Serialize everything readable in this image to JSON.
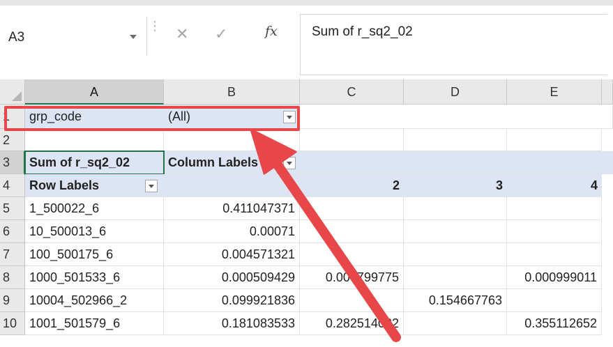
{
  "name_box": {
    "value": "A3"
  },
  "formula_bar": {
    "cancel_glyph": "✕",
    "enter_glyph": "✓",
    "fx_label": "fx",
    "content": "Sum of r_sq2_02"
  },
  "columns": [
    "A",
    "B",
    "C",
    "D",
    "E"
  ],
  "row_numbers": [
    "1",
    "2",
    "3",
    "4",
    "5",
    "6",
    "7",
    "8",
    "9",
    "10"
  ],
  "pivot": {
    "filter_field": "grp_code",
    "filter_value": "(All)",
    "values_label": "Sum of r_sq2_02",
    "column_labels_header": "Column Labels",
    "row_labels_header": "Row Labels",
    "column_keys": {
      "c": "2",
      "d": "3",
      "e": "4"
    },
    "rows": [
      {
        "label": "1_500022_6",
        "b": "0.411047371",
        "c": "",
        "d": "",
        "e": ""
      },
      {
        "label": "10_500013_6",
        "b": "0.00071",
        "c": "",
        "d": "",
        "e": ""
      },
      {
        "label": "100_500175_6",
        "b": "0.004571321",
        "c": "",
        "d": "",
        "e": ""
      },
      {
        "label": "1000_501533_6",
        "b": "0.000509429",
        "c": "0.000799775",
        "d": "",
        "e": "0.000999011"
      },
      {
        "label": "10004_502966_2",
        "b": "0.099921836",
        "c": "",
        "d": "0.154667763",
        "e": ""
      },
      {
        "label": "1001_501579_6",
        "b": "0.181083533",
        "c": "0.282514032",
        "d": "",
        "e": "0.355112652"
      }
    ]
  },
  "annotation": {
    "highlight_color": "#e8474a",
    "arrow_color": "#e8474a"
  },
  "colors": {
    "excel_green": "#217346",
    "pivot_band": "#dde4f3"
  }
}
